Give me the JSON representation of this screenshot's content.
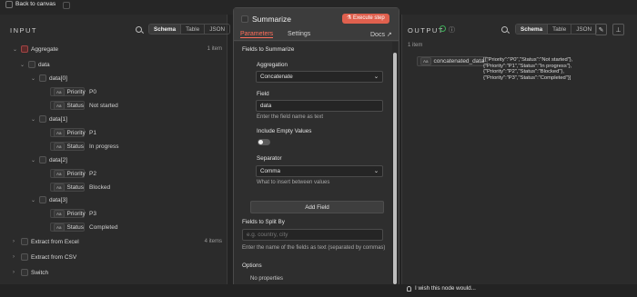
{
  "topbar": {
    "back_label": "Back to canvas"
  },
  "input": {
    "title": "INPUT",
    "views": [
      "Schema",
      "Table",
      "JSON"
    ],
    "active_view": "Schema",
    "tree": [
      {
        "label": "Aggregate",
        "count": "1 item"
      },
      {
        "label": "data"
      },
      {
        "label": "data[0]"
      },
      {
        "field": "Priority",
        "value": "P0"
      },
      {
        "field": "Status",
        "value": "Not started"
      },
      {
        "label": "data[1]"
      },
      {
        "field": "Priority",
        "value": "P1"
      },
      {
        "field": "Status",
        "value": "In progress"
      },
      {
        "label": "data[2]"
      },
      {
        "field": "Priority",
        "value": "P2"
      },
      {
        "field": "Status",
        "value": "Blocked"
      },
      {
        "label": "data[3]"
      },
      {
        "field": "Priority",
        "value": "P3"
      },
      {
        "field": "Status",
        "value": "Completed"
      }
    ],
    "other_nodes": [
      {
        "label": "Extract from Excel",
        "count": "4 items"
      },
      {
        "label": "Extract from CSV",
        "count": ""
      },
      {
        "label": "Switch",
        "count": ""
      }
    ],
    "type_badge": "Aa"
  },
  "node": {
    "title": "Summarize",
    "execute_label": "Execute step",
    "tabs": [
      "Parameters",
      "Settings"
    ],
    "docs_label": "Docs",
    "fields_section": "Fields to Summarize",
    "aggregation_label": "Aggregation",
    "aggregation_value": "Concatenate",
    "field_label": "Field",
    "field_value": "data",
    "field_hint": "Enter the field name as text",
    "include_empty_label": "Include Empty Values",
    "separator_label": "Separator",
    "separator_value": "Comma",
    "separator_hint": "What to insert between values",
    "add_field_label": "Add Field",
    "split_label": "Fields to Split By",
    "split_placeholder": "e.g. country, city",
    "split_hint": "Enter the name of the fields as text (separated by commas)",
    "options_label": "Options",
    "options_value": "No properties"
  },
  "output": {
    "title": "OUTPUT",
    "count": "1 item",
    "views": [
      "Schema",
      "Table",
      "JSON"
    ],
    "active_view": "Schema",
    "field": "concatenated_data",
    "value_lines": [
      "[{\"Priority\":\"P0\",\"Status\":\"Not started\"},",
      "{\"Priority\":\"P1\",\"Status\":\"In progress\"},",
      "{\"Priority\":\"P2\",\"Status\":\"Blocked\"},",
      "{\"Priority\":\"P3\",\"Status\":\"Completed\"}]"
    ],
    "type_badge": "Aa"
  },
  "footer": {
    "wish_label": "I wish this node would..."
  },
  "colors": {
    "accent": "#ff6d5a",
    "execute": "#e0604e",
    "success": "#3fae5a"
  }
}
